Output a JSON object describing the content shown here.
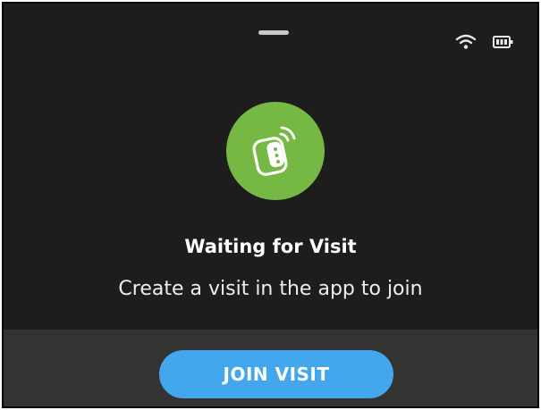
{
  "status_bar": {
    "wifi_icon": "wifi-icon",
    "battery_icon": "battery-icon"
  },
  "status": {
    "icon": "watch-signal-icon",
    "title": "Waiting for Visit",
    "subtitle": "Create a visit in the app to join"
  },
  "footer": {
    "join_label": "JOIN VISIT"
  },
  "colors": {
    "background": "#1d1d1d",
    "footer": "#333333",
    "badge_green": "#75b843",
    "button_blue": "#43a7ee",
    "text": "#ffffff"
  }
}
